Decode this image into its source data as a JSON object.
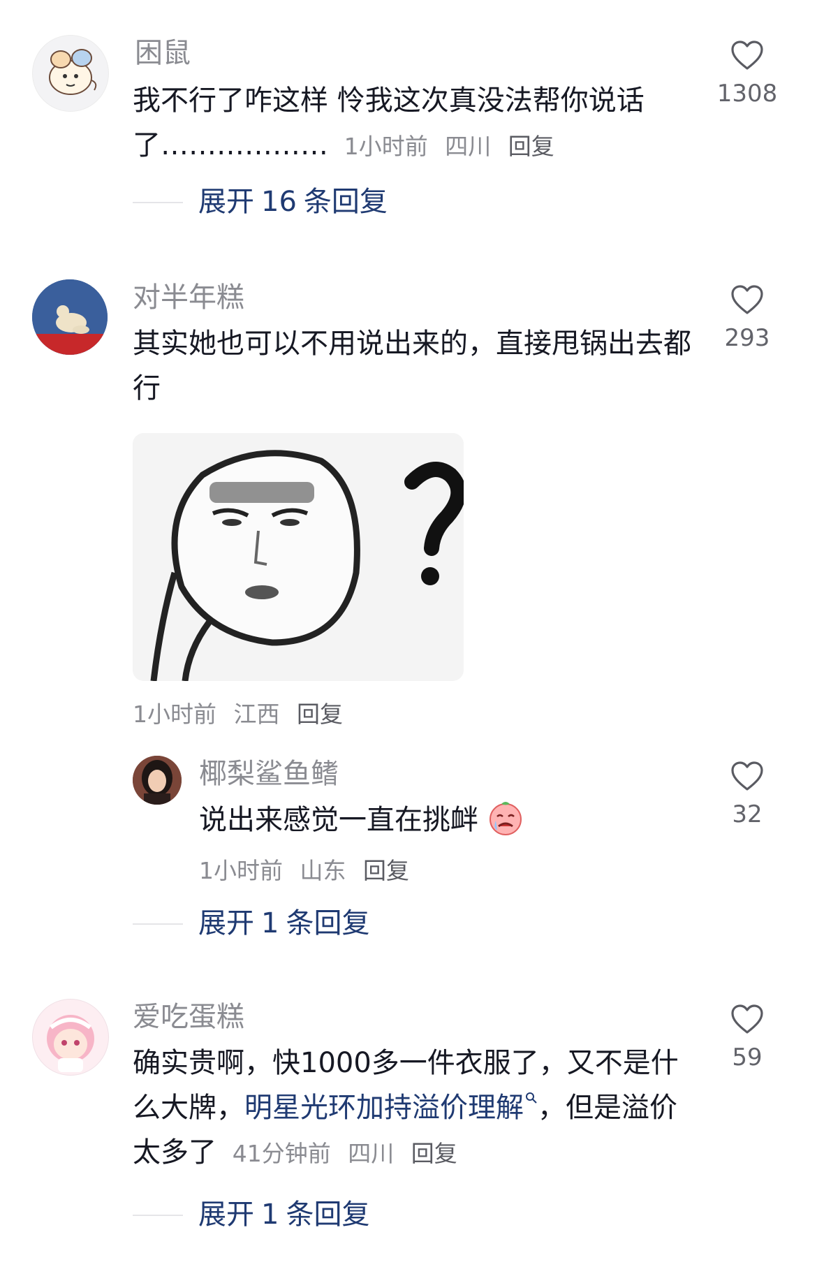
{
  "comments": [
    {
      "username": "困鼠",
      "text": "我不行了咋这样 怜我这次真没法帮你说话了………………",
      "time": "1小时前",
      "location": "四川",
      "reply_label": "回复",
      "likes": "1308",
      "expand": {
        "prefix": "展开",
        "count": "16",
        "suffix": "条回复"
      }
    },
    {
      "username": "对半年糕",
      "text": "其实她也可以不用说出来的，直接甩锅出去都行",
      "time": "1小时前",
      "location": "江西",
      "reply_label": "回复",
      "likes": "293",
      "sticker": "confused-face-meme",
      "reply": {
        "username": "椰梨鲨鱼鳍",
        "text": "说出来感觉一直在挑衅",
        "emoji": "crying-face-emoji",
        "time": "1小时前",
        "location": "山东",
        "reply_label": "回复",
        "likes": "32"
      },
      "expand": {
        "prefix": "展开",
        "count": "1",
        "suffix": "条回复"
      }
    },
    {
      "username": "爱吃蛋糕",
      "text_before": "确实贵啊，快1000多一件衣服了，又不是什么大牌，",
      "link": "明星光环加持溢价理解",
      "text_after": "，但是溢价太多了",
      "time": "41分钟前",
      "location": "四川",
      "reply_label": "回复",
      "likes": "59",
      "expand": {
        "prefix": "展开",
        "count": "1",
        "suffix": "条回复"
      }
    }
  ],
  "colors": {
    "link": "#1f3a72",
    "muted": "#8a8b91",
    "text": "#161823"
  }
}
